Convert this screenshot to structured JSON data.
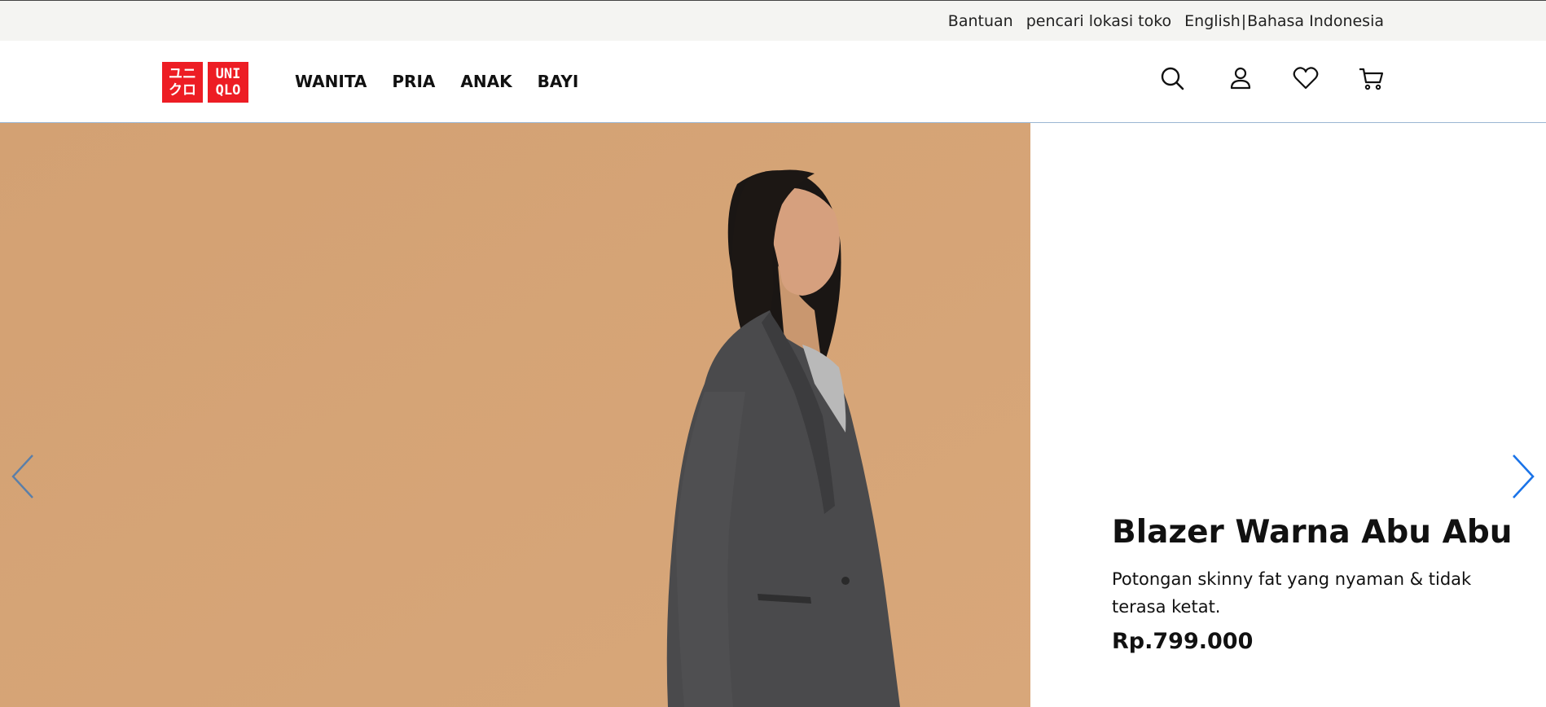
{
  "topbar": {
    "help_label": "Bantuan",
    "store_locator_label": "pencari lokasi toko",
    "lang_english": "English",
    "lang_separator": "|",
    "lang_indonesian": "Bahasa Indonesia"
  },
  "logo": {
    "line1": "ユニ",
    "line2": "クロ",
    "line3": "UNI",
    "line4": "QLO"
  },
  "nav": {
    "items": [
      {
        "label": "WANITA"
      },
      {
        "label": "PRIA"
      },
      {
        "label": "ANAK"
      },
      {
        "label": "BAYI"
      }
    ]
  },
  "header_icons": [
    "search-icon",
    "account-icon",
    "wishlist-heart-icon",
    "cart-icon"
  ],
  "hero": {
    "background_color": "#d4a274",
    "title": "Blazer Warna Abu Abu",
    "description": "Potongan skinny fat yang nyaman & tidak terasa ketat.",
    "price": "Rp.799.000"
  },
  "colors": {
    "brand_red": "#ed1d24",
    "arrow_blue": "#1a73e8"
  }
}
